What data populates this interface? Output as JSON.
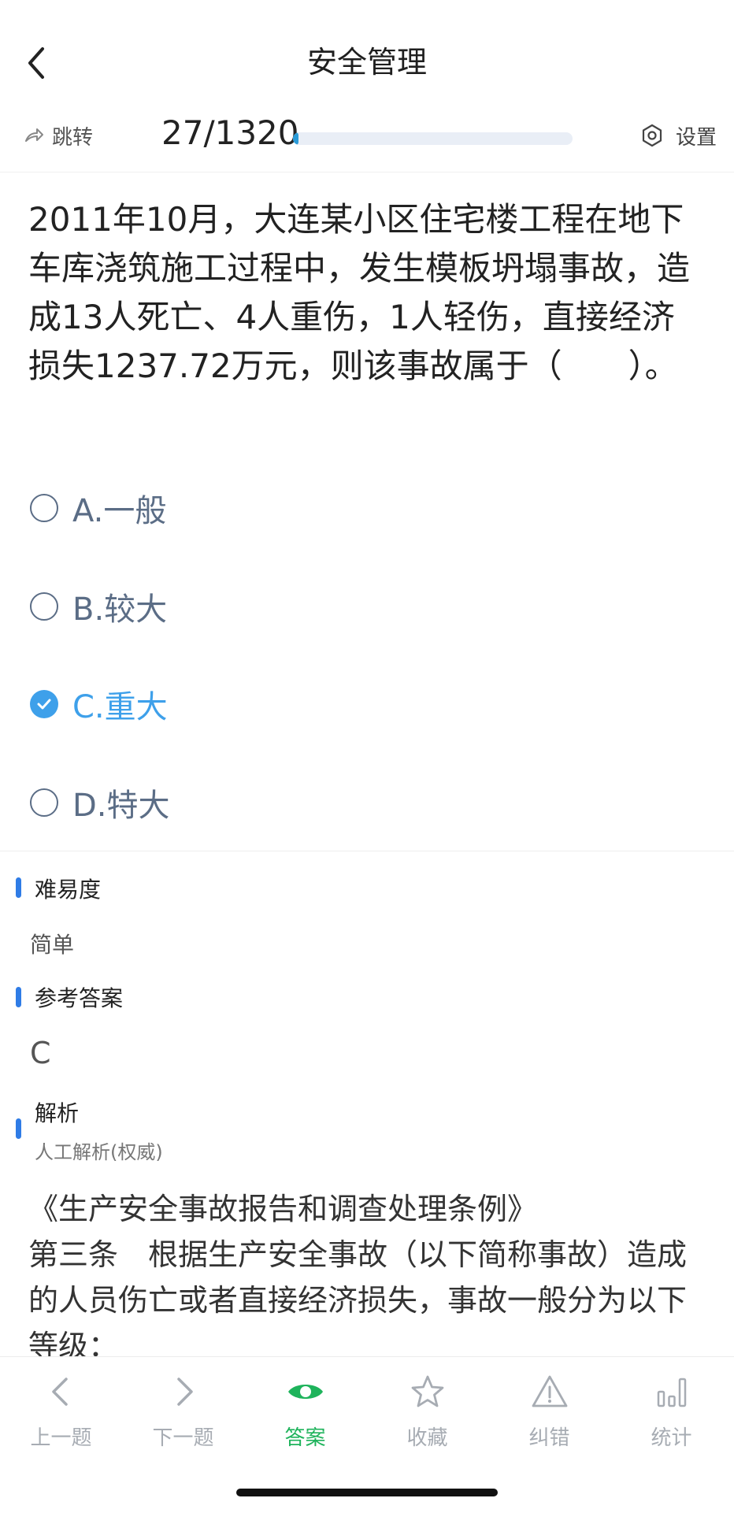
{
  "header": {
    "title": "安全管理"
  },
  "toolbar": {
    "jump_label": "跳转",
    "progress_text": "27/1320",
    "progress_fraction": 0.0205,
    "settings_label": "设置"
  },
  "question": {
    "text": "2011年10月，大连某小区住宅楼工程在地下车库浇筑施工过程中，发生模板坍塌事故，造成13人死亡、4人重伤，1人轻伤，直接经济损失1237.72万元，则该事故属于（　　）。",
    "options": [
      {
        "label": "A.一般",
        "selected": false
      },
      {
        "label": "B.较大",
        "selected": false
      },
      {
        "label": "C.重大",
        "selected": true
      },
      {
        "label": "D.特大",
        "selected": false
      }
    ]
  },
  "difficulty": {
    "title": "难易度",
    "value": "简单"
  },
  "reference_answer": {
    "title": "参考答案",
    "value": "C"
  },
  "analysis": {
    "title": "解析",
    "subtitle": "人工解析(权威)",
    "lines": [
      "《生产安全事故报告和调查处理条例》",
      "第三条　根据生产安全事故（以下简称事故）造成的人员伤亡或者直接经济损失，事故一般分为以下等级："
    ]
  },
  "bottom_nav": [
    {
      "label": "上一题",
      "icon": "chevron-left-icon",
      "active": false
    },
    {
      "label": "下一题",
      "icon": "chevron-right-icon",
      "active": false
    },
    {
      "label": "答案",
      "icon": "eye-icon",
      "active": true
    },
    {
      "label": "收藏",
      "icon": "star-icon",
      "active": false
    },
    {
      "label": "纠错",
      "icon": "warning-icon",
      "active": false
    },
    {
      "label": "统计",
      "icon": "bar-chart-icon",
      "active": false
    }
  ],
  "colors": {
    "accent": "#3ea0ea",
    "progress": "#2a9bd8",
    "section_bar": "#2f7ce6",
    "nav_active": "#1eb35b"
  }
}
